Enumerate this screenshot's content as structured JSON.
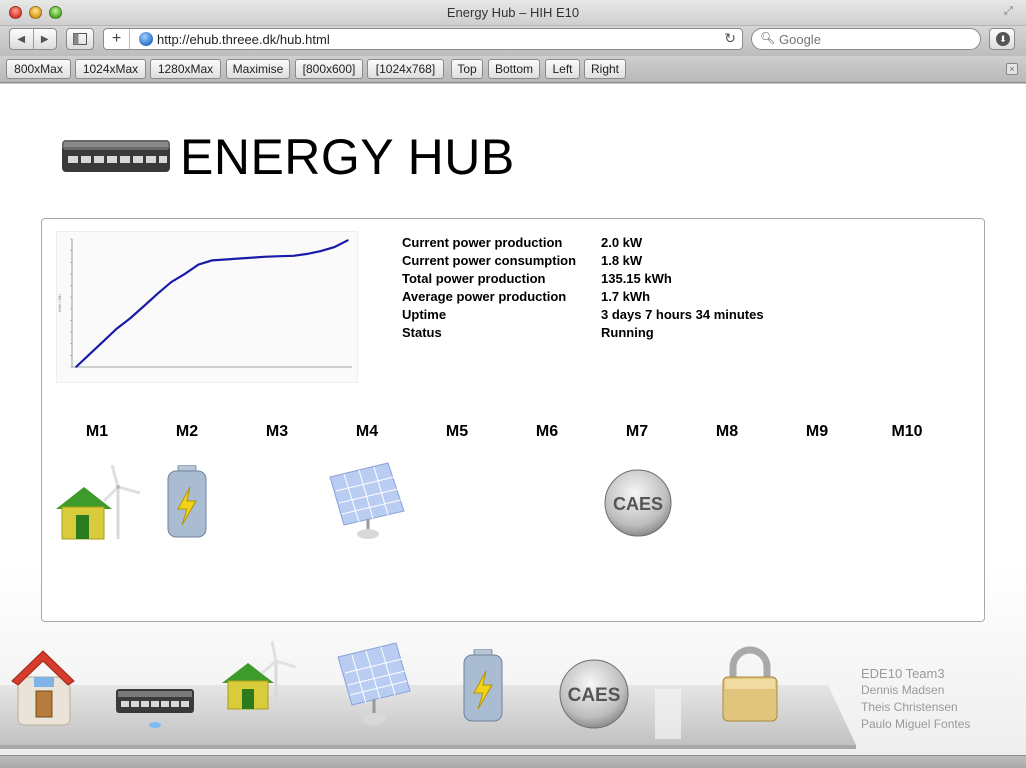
{
  "window": {
    "title": "Energy Hub – HIH E10"
  },
  "toolbar": {
    "back_icon": "back-arrow-icon",
    "forward_icon": "forward-arrow-icon",
    "url": "http://ehub.threee.dk/hub.html",
    "search_placeholder": "Google"
  },
  "bookmarks": [
    "800xMax",
    "1024xMax",
    "1280xMax",
    "Maximise",
    "[800x600]",
    "[1024x768]",
    "Top",
    "Bottom",
    "Left",
    "Right"
  ],
  "header": {
    "title": "ENERGY HUB",
    "logo_icon": "network-switch-icon"
  },
  "stats": [
    {
      "label": "Current power production",
      "value": "2.0 kW"
    },
    {
      "label": "Current power consumption",
      "value": "1.8 kW"
    },
    {
      "label": "Total power production",
      "value": "135.15 kWh"
    },
    {
      "label": "Average power production",
      "value": "1.7 kWh"
    },
    {
      "label": "Uptime",
      "value": "3 days 7 hours 34 minutes"
    },
    {
      "label": "Status",
      "value": "Running"
    }
  ],
  "modules": [
    {
      "label": "M1",
      "icon": "house-wind-turbine-icon"
    },
    {
      "label": "M2",
      "icon": "battery-icon"
    },
    {
      "label": "M3",
      "icon": ""
    },
    {
      "label": "M4",
      "icon": "solar-panel-icon"
    },
    {
      "label": "M5",
      "icon": ""
    },
    {
      "label": "M6",
      "icon": ""
    },
    {
      "label": "M7",
      "icon": "caes-icon"
    },
    {
      "label": "M8",
      "icon": ""
    },
    {
      "label": "M9",
      "icon": ""
    },
    {
      "label": "M10",
      "icon": ""
    }
  ],
  "caes_label": "CAES",
  "dock": {
    "items": [
      "home-icon",
      "network-switch-icon",
      "house-wind-turbine-icon",
      "solar-panel-icon",
      "battery-icon",
      "caes-icon",
      "padlock-icon"
    ]
  },
  "credits": {
    "team": "EDE10 Team3",
    "members": [
      "Dennis Madsen",
      "Theis Christensen",
      "Paulo Miguel Fontes"
    ]
  },
  "chart_data": {
    "type": "line",
    "title": "",
    "xlabel": "",
    "ylabel": "kWh / Wh",
    "x": [
      0,
      1,
      2,
      3,
      4,
      5,
      6,
      7,
      8,
      9,
      10,
      11,
      12,
      13,
      14,
      15,
      16,
      17,
      18,
      19,
      20
    ],
    "series": [
      {
        "values": [
          0,
          55,
          110,
          165,
          210,
          262,
          315,
          365,
          400,
          440,
          458,
          462,
          466,
          470,
          474,
          476,
          478,
          486,
          498,
          515,
          545
        ]
      }
    ],
    "ylim": [
      0,
      550
    ],
    "colors": {
      "line": "#1a1aa8"
    },
    "grid": false
  }
}
